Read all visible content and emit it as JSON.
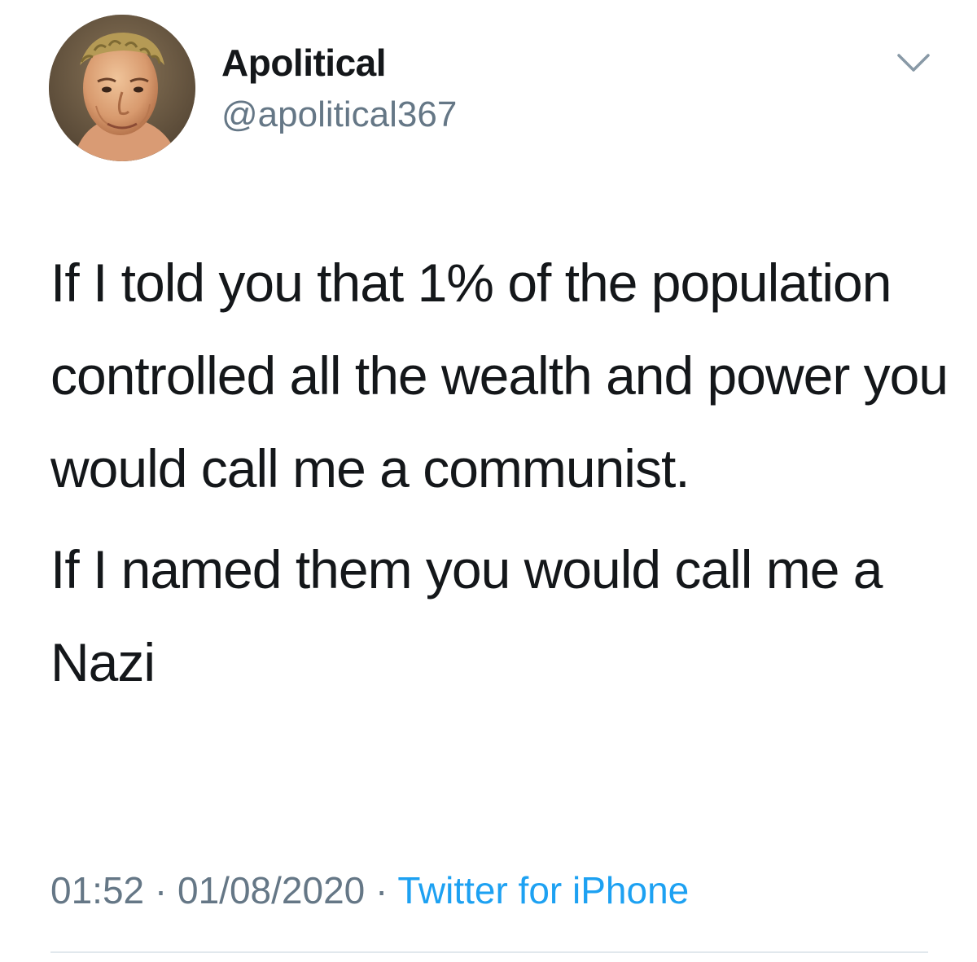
{
  "author": {
    "name": "Apolitical",
    "handle": "@apolitical367",
    "avatar_icon": "laurel-crowned-portrait-avatar"
  },
  "menu": {
    "icon": "chevron-down-icon"
  },
  "tweet": {
    "paragraphs": [
      "If I told you that 1% of the population controlled all the wealth and power you would call me a communist.",
      "If I named them you would call me a Nazi"
    ]
  },
  "meta": {
    "time": "01:52",
    "separator": "·",
    "date": "01/08/2020",
    "source": "Twitter for iPhone"
  },
  "colors": {
    "text": "#14171a",
    "muted": "#657786",
    "link": "#1da1f2",
    "divider": "#e1e8ed"
  }
}
